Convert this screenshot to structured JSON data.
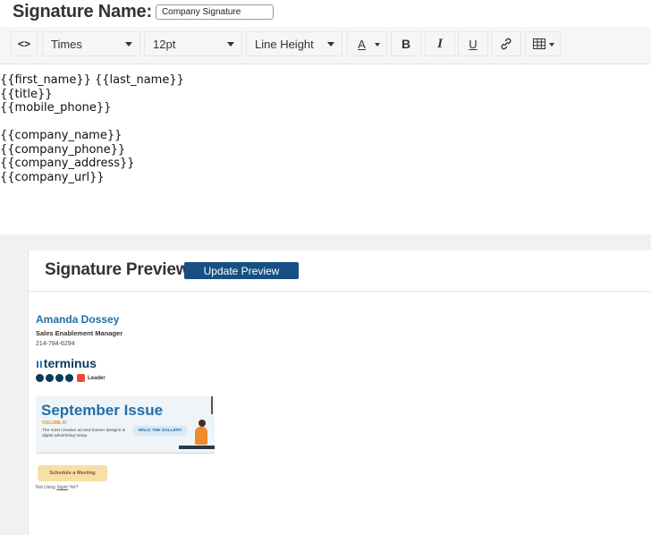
{
  "signature_name": {
    "label": "Signature Name:",
    "value": "Company Signature"
  },
  "toolbar": {
    "code_label": "<>",
    "font_family": "Times",
    "font_size": "12pt",
    "line_height": "Line Height",
    "font_color_label": "A",
    "bold_label": "B",
    "italic_label": "I",
    "underline_label": "U"
  },
  "editor": {
    "lines": [
      "{{first_name}} {{last_name}}",
      "{{title}}",
      "{{mobile_phone}}",
      "",
      "{{company_name}}",
      "{{company_phone}}",
      "{{company_address}}",
      "{{company_url}}"
    ]
  },
  "preview": {
    "title": "Signature Preview",
    "update_button": "Update Preview",
    "name": "Amanda Dossey",
    "job_title": "Sales Enablement Manager",
    "phone": "214-784-6294",
    "logo_text": "terminus",
    "badge_label": "Leader",
    "banner": {
      "title": "September Issue",
      "volume": "VOLUME III",
      "description": "The most creative ad and banner designs in digital advertising today.",
      "cta": "WALK THE GALLERY"
    },
    "schedule_button": "Schedule a Meeting",
    "footer_text": "Not Using ",
    "footer_link": "Sigstr",
    "footer_suffix": " Yet?"
  },
  "colors": {
    "accent": "#174f82",
    "name_blue": "#1f6fa8",
    "toolbar_bg": "#f6f6f6",
    "lower_bg": "#f1f1f1"
  },
  "icons": [
    "code-icon",
    "bold-icon",
    "italic-icon",
    "underline-icon",
    "link-icon",
    "table-icon",
    "font-color-icon"
  ]
}
